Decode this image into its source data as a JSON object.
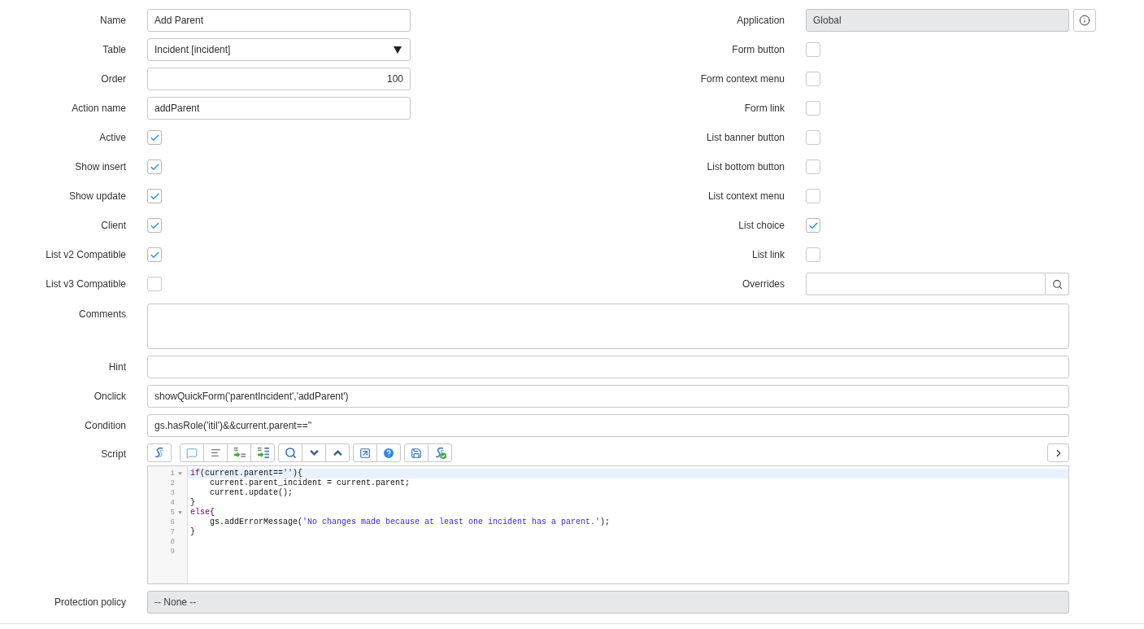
{
  "left_fields": [
    {
      "kind": "text",
      "label": "Name",
      "value": "Add Parent"
    },
    {
      "kind": "select",
      "label": "Table",
      "value": "Incident [incident]"
    },
    {
      "kind": "number",
      "label": "Order",
      "value": "100"
    },
    {
      "kind": "text",
      "label": "Action name",
      "value": "addParent"
    },
    {
      "kind": "checkbox",
      "label": "Active",
      "checked": true
    },
    {
      "kind": "checkbox",
      "label": "Show insert",
      "checked": true
    },
    {
      "kind": "checkbox",
      "label": "Show update",
      "checked": true
    },
    {
      "kind": "checkbox",
      "label": "Client",
      "checked": true
    },
    {
      "kind": "checkbox",
      "label": "List v2 Compatible",
      "checked": true
    },
    {
      "kind": "checkbox",
      "label": "List v3 Compatible",
      "checked": false
    }
  ],
  "right_fields": [
    {
      "kind": "readonly_info",
      "label": "Application",
      "value": "Global"
    },
    {
      "kind": "checkbox",
      "label": "Form button",
      "checked": false
    },
    {
      "kind": "checkbox",
      "label": "Form context menu",
      "checked": false
    },
    {
      "kind": "checkbox",
      "label": "Form link",
      "checked": false
    },
    {
      "kind": "checkbox",
      "label": "List banner button",
      "checked": false
    },
    {
      "kind": "checkbox",
      "label": "List bottom button",
      "checked": false
    },
    {
      "kind": "checkbox",
      "label": "List context menu",
      "checked": false
    },
    {
      "kind": "checkbox",
      "label": "List choice",
      "checked": true
    },
    {
      "kind": "checkbox",
      "label": "List link",
      "checked": false
    },
    {
      "kind": "lookup",
      "label": "Overrides"
    }
  ],
  "wide_fields": [
    {
      "kind": "textarea",
      "label": "Comments"
    },
    {
      "kind": "text",
      "label": "Hint"
    },
    {
      "kind": "text",
      "label": "Onclick",
      "value": "showQuickForm('parentIncident','addParent')"
    },
    {
      "kind": "text",
      "label": "Condition",
      "value": "gs.hasRole('itil')&&current.parent==''"
    },
    {
      "kind": "script",
      "label": "Script",
      "lines": [
        {
          "number": "1",
          "foldable": true,
          "active": true,
          "tokens": [
            {
              "kind": "keyword",
              "text": "if"
            },
            {
              "kind": "plain",
              "text": "(current.parent=="
            },
            {
              "kind": "string",
              "text": "''"
            },
            {
              "kind": "plain",
              "text": "){"
            }
          ]
        },
        {
          "number": "2",
          "foldable": false,
          "active": false,
          "tokens": [
            {
              "kind": "plain",
              "text": "    current.parent_incident = current.parent;"
            }
          ]
        },
        {
          "number": "3",
          "foldable": false,
          "active": false,
          "tokens": [
            {
              "kind": "plain",
              "text": "    current.update();"
            }
          ]
        },
        {
          "number": "4",
          "foldable": false,
          "active": false,
          "tokens": [
            {
              "kind": "plain",
              "text": "}"
            }
          ]
        },
        {
          "number": "5",
          "foldable": true,
          "active": false,
          "tokens": [
            {
              "kind": "keyword",
              "text": "else"
            },
            {
              "kind": "plain",
              "text": "{"
            }
          ]
        },
        {
          "number": "6",
          "foldable": false,
          "active": false,
          "tokens": [
            {
              "kind": "plain",
              "text": "    gs.addErrorMessage("
            },
            {
              "kind": "string",
              "text": "'No changes made because at least one incident has a parent.'"
            },
            {
              "kind": "plain",
              "text": ");"
            }
          ]
        },
        {
          "number": "7",
          "foldable": false,
          "active": false,
          "tokens": [
            {
              "kind": "plain",
              "text": "}"
            }
          ]
        },
        {
          "number": "8",
          "foldable": false,
          "active": false
        },
        {
          "number": "9",
          "foldable": false,
          "active": false
        }
      ]
    },
    {
      "kind": "readonly",
      "label": "Protection policy",
      "value": "-- None --"
    }
  ]
}
